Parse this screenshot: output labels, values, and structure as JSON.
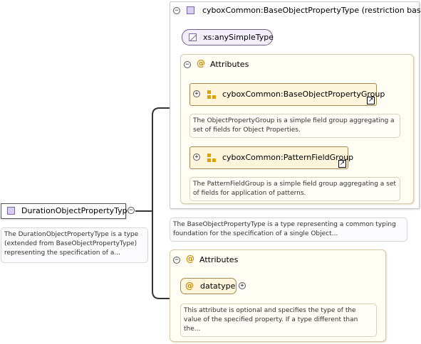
{
  "root": {
    "name": "DurationObjectPropertyType",
    "toggle": "−",
    "description": "The DurationObjectPropertyType is a type (extended from BaseObjectPropertyType) representing the specification of a..."
  },
  "base": {
    "toggle": "−",
    "name": "cyboxCommon:BaseObjectPropertyType (restriction base)",
    "simple_type": "xs:anySimpleType",
    "attributes": {
      "toggle": "−",
      "icon": "@",
      "label": "Attributes",
      "groups": [
        {
          "toggle": "+",
          "name": "cyboxCommon:BaseObjectPropertyGroup",
          "link": "↗",
          "description": "The ObjectPropertyGroup is a simple field group aggregating a set of fields for Object Properties."
        },
        {
          "toggle": "+",
          "name": "cyboxCommon:PatternFieldGroup",
          "link": "↗",
          "description": "The PatternFieldGroup is a simple field group aggregating a set of fields for application of patterns."
        }
      ]
    },
    "description": "The BaseObjectPropertyType is a type representing a common typing foundation for the specification of a single Object..."
  },
  "ext_attributes": {
    "toggle": "−",
    "icon": "@",
    "label": "Attributes",
    "attr": {
      "icon": "@",
      "name": "datatype",
      "toggle": "+",
      "description": "This attribute is optional and specifies the type of the value of the specified property. If a type different than the..."
    }
  },
  "colors": {
    "type_icon": "#d8cff0",
    "group_fill": "#fdf5dc",
    "attribute_icon": "#c98a00"
  }
}
